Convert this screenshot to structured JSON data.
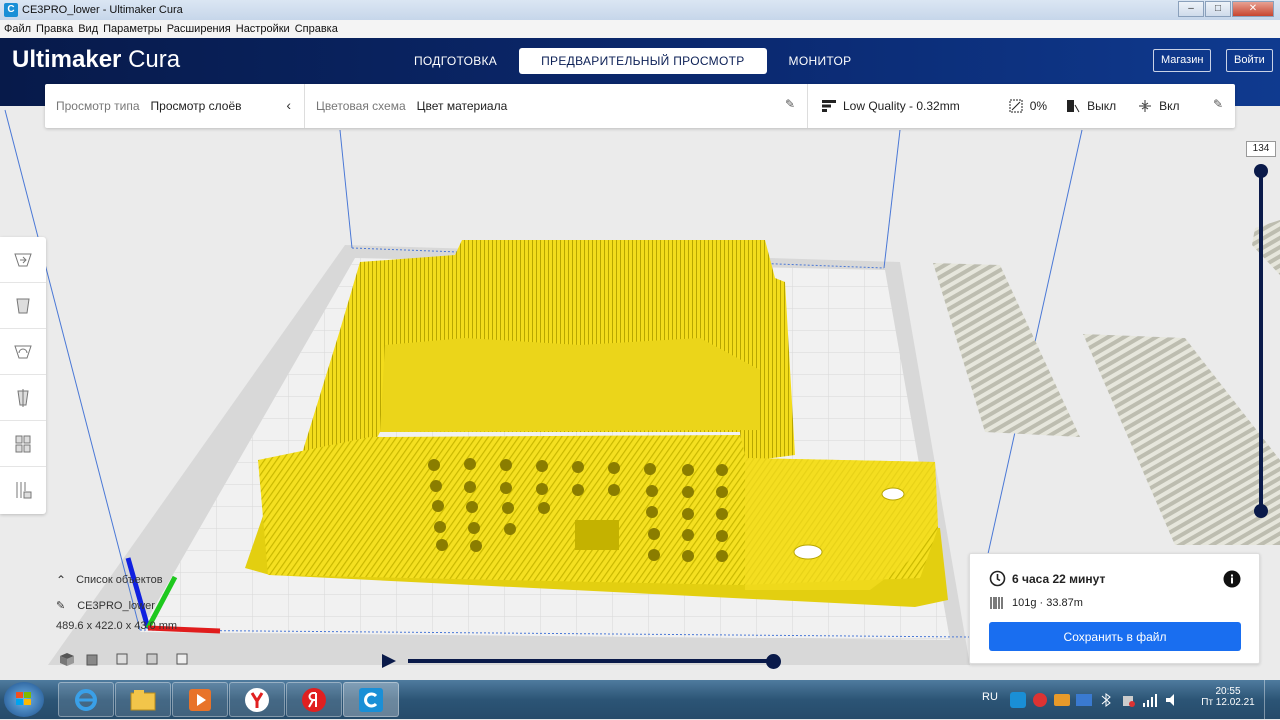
{
  "window": {
    "title": "CE3PRO_lower - Ultimaker Cura",
    "minimize": "–",
    "maximize": "□",
    "close": "✕"
  },
  "menu": [
    "Файл",
    "Правка",
    "Вид",
    "Параметры",
    "Расширения",
    "Настройки",
    "Справка"
  ],
  "header": {
    "logo_main": "Ultimaker",
    "logo_sub": "Cura",
    "stages": [
      "ПОДГОТОВКА",
      "ПРЕДВАРИТЕЛЬНЫЙ ПРОСМОТР",
      "МОНИТОР"
    ],
    "active_stage": "ПРЕДВАРИТЕЛЬНЫЙ ПРОСМОТР",
    "marketplace": "Магазин",
    "signin": "Войти"
  },
  "view_bar": {
    "view_type_label": "Просмотр типа",
    "view_type_value": "Просмотр слоёв",
    "color_scheme_label": "Цветовая схема",
    "color_scheme_value": "Цвет материала",
    "profile": "Low Quality - 0.32mm",
    "infill": "0%",
    "support": "Выкл",
    "adhesion": "Вкл"
  },
  "layer_view": {
    "current_layer": "134"
  },
  "objects": {
    "list_label": "Список объектов",
    "object_name": "CE3PRO_lower",
    "dimensions": "489.6 x 422.0 x 43.0 mm"
  },
  "print_info": {
    "time": "6 часа 22 минут",
    "material": "101g · 33.87m",
    "save_button": "Сохранить в файл"
  },
  "tray": {
    "lang": "RU",
    "time": "20:55",
    "date": "Пт 12.02.21"
  },
  "colors": {
    "header_dark": "#071a4a",
    "accent_blue": "#196ef0",
    "model_yellow": "#f5e020"
  }
}
